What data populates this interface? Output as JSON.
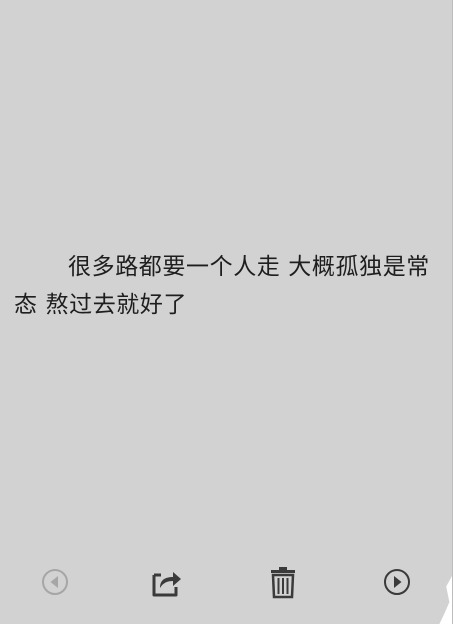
{
  "note": {
    "text": "很多路都要一个人走 大概孤独是常态 熬过去就好了"
  },
  "toolbar": {
    "buttons": [
      {
        "name": "previous",
        "icon": "arrow-left-circle-icon",
        "enabled": false
      },
      {
        "name": "share",
        "icon": "share-export-icon",
        "enabled": true
      },
      {
        "name": "delete",
        "icon": "trash-icon",
        "enabled": true
      },
      {
        "name": "next",
        "icon": "arrow-right-circle-icon",
        "enabled": true
      }
    ]
  },
  "colors": {
    "background": "#d2d2d2",
    "text": "#1e1e1e",
    "icon_active": "#3a3a3a",
    "icon_disabled": "#a6a6a6"
  }
}
